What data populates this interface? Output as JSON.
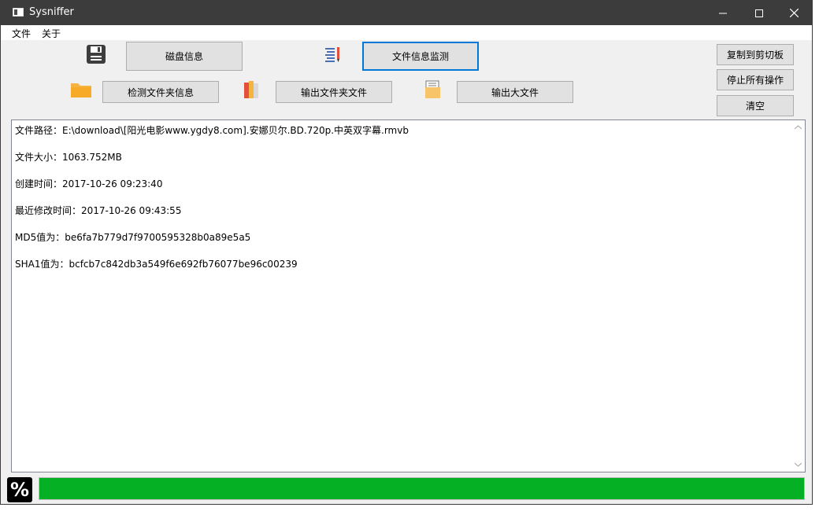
{
  "window": {
    "title": "Sysniffer"
  },
  "menu": {
    "file": "文件",
    "about": "关于"
  },
  "toolbar": {
    "disk_info": "磁盘信息",
    "file_monitor": "文件信息监测",
    "check_folder": "检测文件夹信息",
    "export_folder_files": "输出文件夹文件",
    "export_large_files": "输出大文件",
    "copy_clipboard": "复制到剪切板",
    "stop_all": "停止所有操作",
    "clear": "清空"
  },
  "output": {
    "lines": [
      "文件路径：E:\\download\\[阳光电影www.ygdy8.com].安娜贝尔.BD.720p.中英双字幕.rmvb",
      "文件大小：1063.752MB",
      "创建时间：2017-10-26 09:23:40",
      "最近修改时间：2017-10-26 09:43:55",
      "MD5值为：be6fa7b779d7f9700595328b0a89e5a5",
      "SHA1值为：bcfcb7c842db3a549f6e692fb76077be96c00239"
    ]
  },
  "progress": {
    "label": "%",
    "value_percent": 100,
    "fill_color": "#06b025"
  },
  "colors": {
    "titlebar": "#3c3c3c",
    "focus": "#0078d7",
    "progress": "#06b025"
  }
}
